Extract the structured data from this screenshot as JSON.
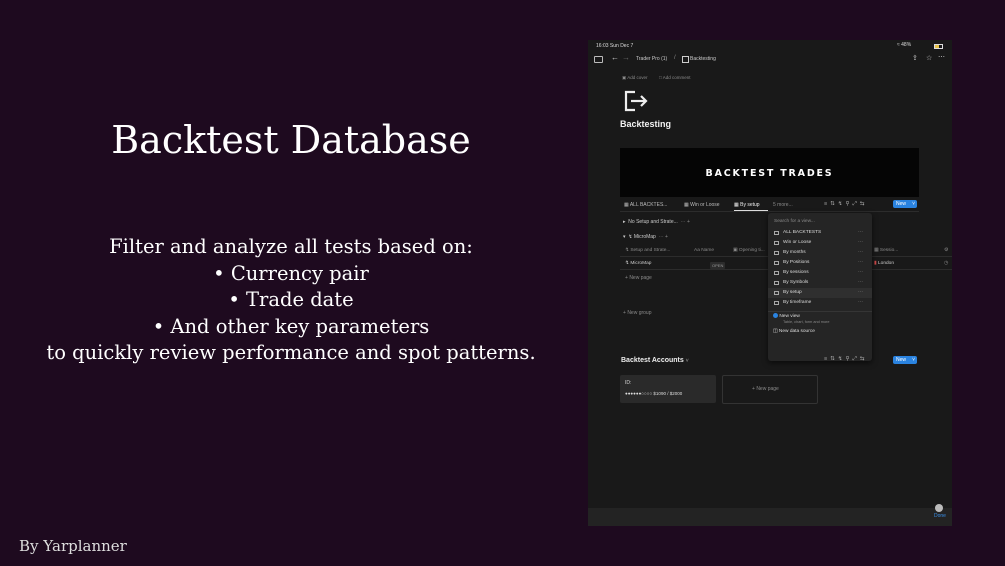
{
  "slide": {
    "title": "Backtest Database",
    "body_lines": [
      "Filter and analyze all tests based on:",
      "• Currency pair",
      "• Trade date",
      "• And other key parameters",
      "to quickly review performance and spot patterns."
    ],
    "author": "By Yarplanner"
  },
  "status_bar": {
    "time": "16:03",
    "date": "Sun Dec 7",
    "battery": "48%"
  },
  "breadcrumb": {
    "workspace": "Trader Pro (1)",
    "page": "Backtesting"
  },
  "page": {
    "add_cover": "Add cover",
    "add_comment": "Add comment",
    "title": "Backtesting",
    "banner_text": "BACKTEST TRADES"
  },
  "views": {
    "tabs": [
      "ALL BACKTES...",
      "Win or Loose",
      "By setup",
      "5 more..."
    ],
    "new_label": "New"
  },
  "groups": {
    "group1": "No Setup and Strate...",
    "group2": "MicroMap",
    "columns": [
      "Setup and Strate...",
      "Name",
      "Opening ti...",
      "Sessio..."
    ],
    "row_setup": "MicroMap",
    "row_status": "OPEN",
    "row_session": "London",
    "new_page": "New page",
    "new_group": "New group"
  },
  "popup": {
    "search_placeholder": "Search for a view...",
    "items": [
      "ALL BACKTESTS",
      "Win or Loose",
      "By months",
      "By Positions",
      "By sessions",
      "By Symbols",
      "By setup",
      "By timeframe"
    ],
    "new_view": "New view",
    "new_view_sub": "Table, chart, form and more",
    "new_data_source": "New data source"
  },
  "accounts": {
    "title": "Backtest Accounts",
    "new_label": "New",
    "card_id": "ID:",
    "card_progress": "●●●●●●○○○○ $1090 / $2000",
    "new_page": "New page"
  },
  "bottom": {
    "done": "Done"
  },
  "colors": {
    "background": "#1e0a1f",
    "accent": "#2a83e0",
    "app_bg": "#191919"
  }
}
